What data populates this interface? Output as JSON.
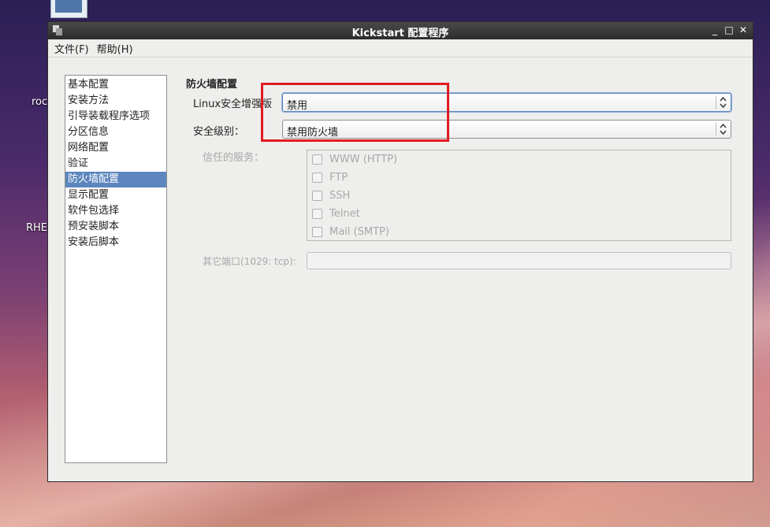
{
  "desktop": {
    "label_1": "roc",
    "label_2": "RHE"
  },
  "window": {
    "title": "Kickstart 配置程序",
    "controls": {
      "minimize": "_",
      "maximize": "□",
      "close": "✕"
    }
  },
  "menubar": {
    "file": "文件(F)",
    "help": "帮助(H)"
  },
  "nav": {
    "items": [
      "基本配置",
      "安装方法",
      "引导装载程序选项",
      "分区信息",
      "网络配置",
      "验证",
      "防火墙配置",
      "显示配置",
      "软件包选择",
      "预安装脚本",
      "安装后脚本"
    ],
    "selected": "防火墙配置"
  },
  "firewall": {
    "section_title": "防火墙配置",
    "selinux_label": "Linux安全增强版",
    "selinux_value": "禁用",
    "security_level_label": "安全级别：",
    "security_level_value": "禁用防火墙",
    "trusted_services_label": "信任的服务：",
    "services": [
      {
        "name": "WWW (HTTP)",
        "checked": false
      },
      {
        "name": "FTP",
        "checked": false
      },
      {
        "name": "SSH",
        "checked": false
      },
      {
        "name": "Telnet",
        "checked": false
      },
      {
        "name": "Mail (SMTP)",
        "checked": false
      }
    ],
    "other_ports_label": "其它端口(1029: tcp):",
    "other_ports_value": ""
  },
  "colors": {
    "selection": "#5c86bd",
    "annotation": "#e01b22",
    "titlebar": "#2c2c2c"
  }
}
